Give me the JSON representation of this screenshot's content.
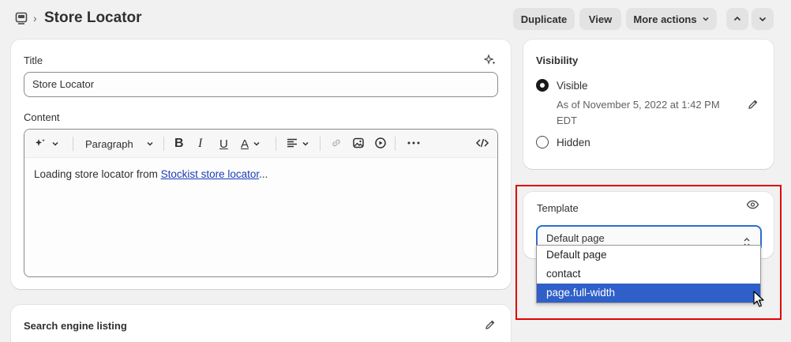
{
  "header": {
    "title": "Store Locator",
    "breadcrumb_separator": "›",
    "actions": {
      "duplicate": "Duplicate",
      "view": "View",
      "more_actions": "More actions"
    }
  },
  "main": {
    "title_label": "Title",
    "title_value": "Store Locator",
    "content_label": "Content",
    "toolbar": {
      "paragraph": "Paragraph",
      "bold": "B",
      "italic": "I",
      "underline": "U",
      "text_color": "A"
    },
    "content": {
      "prefix": "Loading store locator from ",
      "link": "Stockist store locator",
      "suffix": "..."
    },
    "seo_label": "Search engine listing"
  },
  "visibility": {
    "heading": "Visibility",
    "visible_label": "Visible",
    "visible_date_line1": "As of November 5, 2022 at 1:42 PM",
    "visible_date_line2": "EDT",
    "hidden_label": "Hidden",
    "selected": "Visible"
  },
  "template": {
    "label": "Template",
    "selected": "Default page",
    "options": [
      "Default page",
      "contact",
      "page.full-width"
    ],
    "highlighted_option": "page.full-width"
  },
  "colors": {
    "accent_focus": "#2c6ecb",
    "option_highlight": "#2f5fc8",
    "annotation_box": "#e00000"
  }
}
